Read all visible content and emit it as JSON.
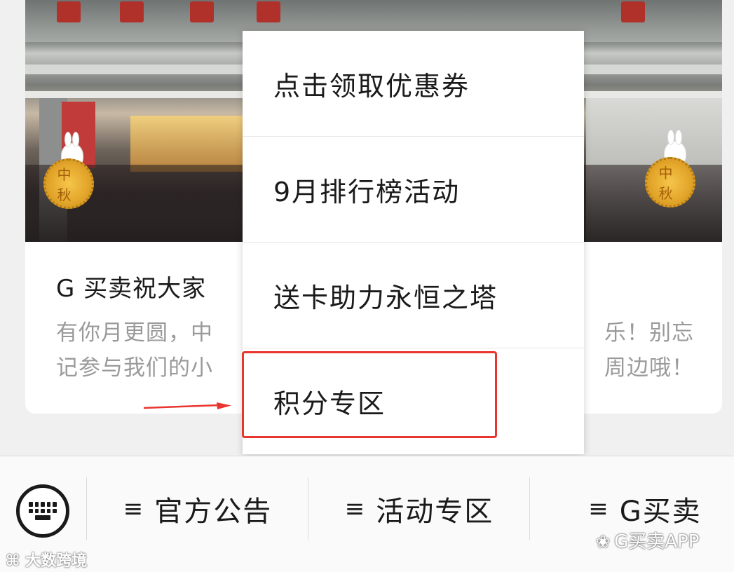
{
  "article": {
    "title_visible": "G 买卖祝大家",
    "description_lines": [
      [
        "有你月更圆，中",
        "乐！别忘"
      ],
      [
        "记参与我们的小",
        "周边哦！"
      ]
    ],
    "mooncake_glyph": "中秋"
  },
  "popup_menu": {
    "items": [
      {
        "label": "点击领取优惠券"
      },
      {
        "label": "9月排行榜活动"
      },
      {
        "label": "送卡助力永恒之塔"
      },
      {
        "label": "积分专区"
      }
    ],
    "highlighted_index": 3,
    "highlight_color": "#e8352e"
  },
  "bottom_bar": {
    "keyboard_icon": "keyboard-icon",
    "tabs": [
      {
        "icon": "≡",
        "label": "官方公告"
      },
      {
        "icon": "≡",
        "label": "活动专区"
      },
      {
        "icon": "≡",
        "label": "G买卖"
      }
    ]
  },
  "watermarks": {
    "left": "大数跨境",
    "right": "G买卖APP"
  }
}
